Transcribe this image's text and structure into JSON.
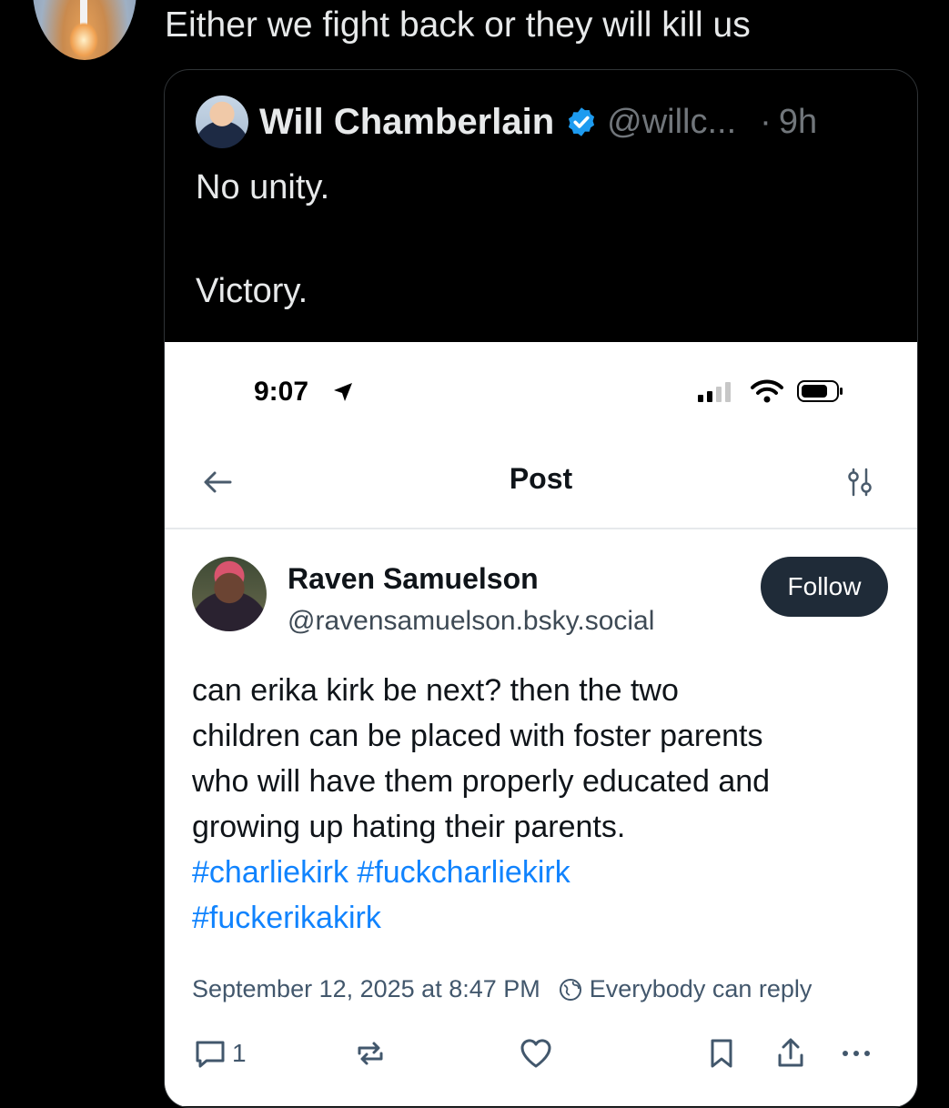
{
  "post": {
    "text": "Either we fight back or they will kill us"
  },
  "quoted": {
    "name": "Will Chamberlain",
    "handle": "@willc...",
    "separator": "·",
    "time": "9h",
    "line1": "No unity.",
    "line2": "Victory."
  },
  "screenshot": {
    "status_time": "9:07",
    "title": "Post",
    "author_name": "Raven Samuelson",
    "author_handle": "@ravensamuelson.bsky.social",
    "follow_label": "Follow",
    "body_lines": [
      "can erika kirk be next? then the two",
      "children can be placed with foster parents",
      "who will have them properly educated and",
      "growing up hating their parents."
    ],
    "hashtags": [
      "#charliekirk",
      "#fuckcharliekirk",
      "#fuckerikakirk"
    ],
    "timestamp": "September 12, 2025 at 8:47 PM",
    "reply_setting": "Everybody can reply",
    "reply_count": "1"
  },
  "colors": {
    "background": "#000000",
    "hashtag": "#1083fe",
    "verified": "#1d9bf0",
    "follow_button": "#1f2b38"
  }
}
